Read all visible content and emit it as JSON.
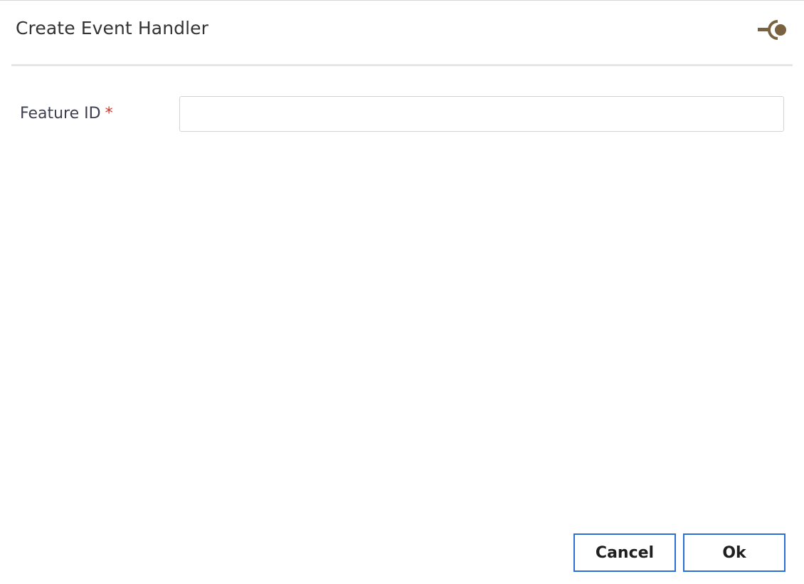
{
  "dialog": {
    "title": "Create Event Handler",
    "pin_icon": "pin-icon",
    "accent_color": "#7a6240"
  },
  "form": {
    "feature_id": {
      "label": "Feature ID",
      "required_marker": "*",
      "value": "",
      "placeholder": ""
    }
  },
  "actions": {
    "cancel_label": "Cancel",
    "ok_label": "Ok",
    "button_border_color": "#2a6ed8"
  }
}
